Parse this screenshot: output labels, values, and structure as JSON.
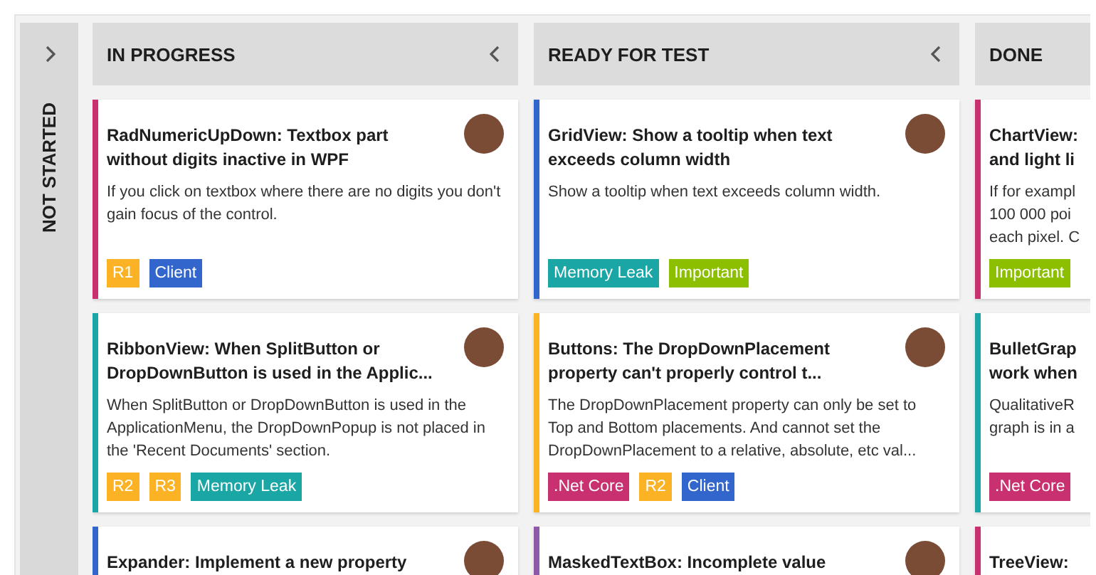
{
  "collapsed_column": {
    "title": "NOT STARTED"
  },
  "columns": [
    {
      "title": "IN PROGRESS",
      "collapse_button": true,
      "cards": [
        {
          "title": "RadNumericUpDown: Textbox part without digits inactive in WPF",
          "description": "If you click on textbox where there are no digits you don't gain focus of the control.",
          "color": "#c9306f",
          "avatar": true,
          "tags": [
            {
              "label": "R1",
              "color": "#fbb325"
            },
            {
              "label": "Client",
              "color": "#3366cc"
            }
          ]
        },
        {
          "title": "RibbonView: When SplitButton or DropDownButton is used in the Applic...",
          "description": "When SplitButton or DropDownButton is used in the ApplicationMenu, the DropDownPopup is not placed in the 'Recent Documents' section.",
          "color": "#1aa6a5",
          "avatar": true,
          "tags": [
            {
              "label": "R2",
              "color": "#fbb325"
            },
            {
              "label": "R3",
              "color": "#fbb325"
            },
            {
              "label": "Memory Leak",
              "color": "#1aa6a5"
            }
          ]
        },
        {
          "title": "Expander: Implement a new property",
          "color": "#3366cc",
          "avatar": true
        }
      ]
    },
    {
      "title": "READY FOR TEST",
      "collapse_button": true,
      "cards": [
        {
          "title": "GridView: Show a tooltip when text exceeds column width",
          "description": "Show a tooltip when text exceeds column width.",
          "color": "#3366cc",
          "avatar": true,
          "tags": [
            {
              "label": "Memory Leak",
              "color": "#1aa6a5"
            },
            {
              "label": "Important",
              "color": "#8cbf00"
            }
          ]
        },
        {
          "title": "Buttons: The DropDownPlacement property can't properly control t...",
          "description": "The DropDownPlacement property can only be set to Top and Bottom placements. And cannot set the DropDownPlacement to a relative, absolute, etc val...",
          "color": "#fbb325",
          "avatar": true,
          "tags": [
            {
              "label": ".Net Core",
              "color": "#c9306f"
            },
            {
              "label": "R2",
              "color": "#fbb325"
            },
            {
              "label": "Client",
              "color": "#3366cc"
            }
          ]
        },
        {
          "title": "MaskedTextBox: Incomplete value",
          "color": "#8e57a8",
          "avatar": true
        }
      ]
    },
    {
      "title": "DONE",
      "cards": [
        {
          "title": "ChartView:\nand light li",
          "description": "If for exampl\n100 000 poi\neach pixel. C",
          "color": "#c9306f",
          "tags": [
            {
              "label": "Important",
              "color": "#8cbf00"
            }
          ]
        },
        {
          "title": "BulletGrap\nwork when",
          "description": "QualitativeR\ngraph is in a",
          "color": "#1aa6a5",
          "tags": [
            {
              "label": ".Net Core",
              "color": "#c9306f"
            }
          ]
        },
        {
          "title": "TreeView:",
          "color": "#c9306f"
        }
      ]
    }
  ]
}
